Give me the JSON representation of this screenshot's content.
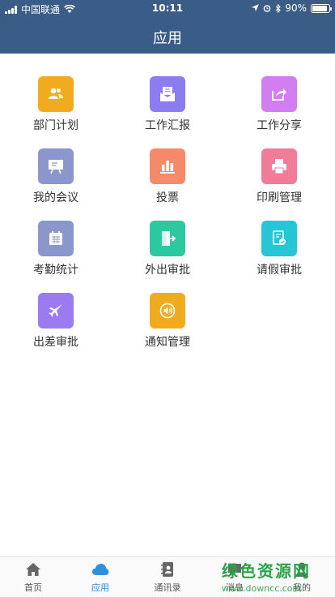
{
  "status_bar": {
    "carrier": "中国联通",
    "time": "10:11",
    "battery": "90%",
    "battery_level": 0.9
  },
  "header": {
    "title": "应用"
  },
  "apps": [
    {
      "label": "部门计划",
      "icon": "department-icon",
      "color": "#f0ac1e"
    },
    {
      "label": "工作汇报",
      "icon": "report-icon",
      "color": "#8d7cf0"
    },
    {
      "label": "工作分享",
      "icon": "share-icon",
      "color": "#d27ef0"
    },
    {
      "label": "我的会议",
      "icon": "meeting-icon",
      "color": "#8b96cc"
    },
    {
      "label": "投票",
      "icon": "vote-icon",
      "color": "#f58a6b"
    },
    {
      "label": "印刷管理",
      "icon": "print-icon",
      "color": "#f07c9a"
    },
    {
      "label": "考勤统计",
      "icon": "calendar-icon",
      "color": "#8b96cc"
    },
    {
      "label": "外出审批",
      "icon": "exit-icon",
      "color": "#2cc8a0"
    },
    {
      "label": "请假审批",
      "icon": "leave-icon",
      "color": "#27c6d6"
    },
    {
      "label": "出差审批",
      "icon": "plane-icon",
      "color": "#9a7cf0"
    },
    {
      "label": "通知管理",
      "icon": "speaker-icon",
      "color": "#f0ac1e"
    }
  ],
  "tabs": [
    {
      "label": "首页",
      "icon": "home-icon",
      "active": false
    },
    {
      "label": "应用",
      "icon": "cloud-icon",
      "active": true
    },
    {
      "label": "通讯录",
      "icon": "contacts-icon",
      "active": false
    },
    {
      "label": "消息",
      "icon": "message-icon",
      "active": false
    },
    {
      "label": "我的",
      "icon": "profile-icon",
      "active": false
    }
  ],
  "watermark": {
    "line1": "绿色资源网",
    "line2": "www.downcc.com"
  }
}
